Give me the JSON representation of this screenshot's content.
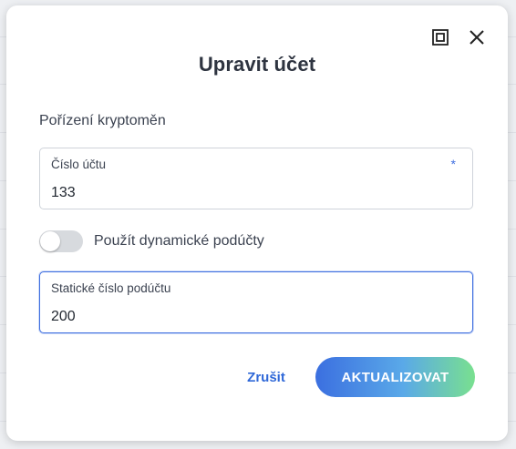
{
  "dialog": {
    "title": "Upravit účet",
    "section_label": "Pořízení kryptoměn"
  },
  "account_field": {
    "label": "Číslo účtu",
    "required_marker": "*",
    "value": "133"
  },
  "dynamic_subaccounts_toggle": {
    "label": "Použít dynamické podúčty",
    "enabled": false
  },
  "static_subaccount_field": {
    "label": "Statické číslo podúčtu",
    "value": "200"
  },
  "actions": {
    "cancel_label": "Zrušit",
    "submit_label": "AKTUALIZOVAT"
  },
  "colors": {
    "accent": "#3f6fe0",
    "gradient_start": "#3b6fe0",
    "gradient_end": "#79e08f",
    "toggle_off": "#d7dade"
  },
  "icons": {
    "maximize": "maximize-icon",
    "close": "close-icon"
  }
}
